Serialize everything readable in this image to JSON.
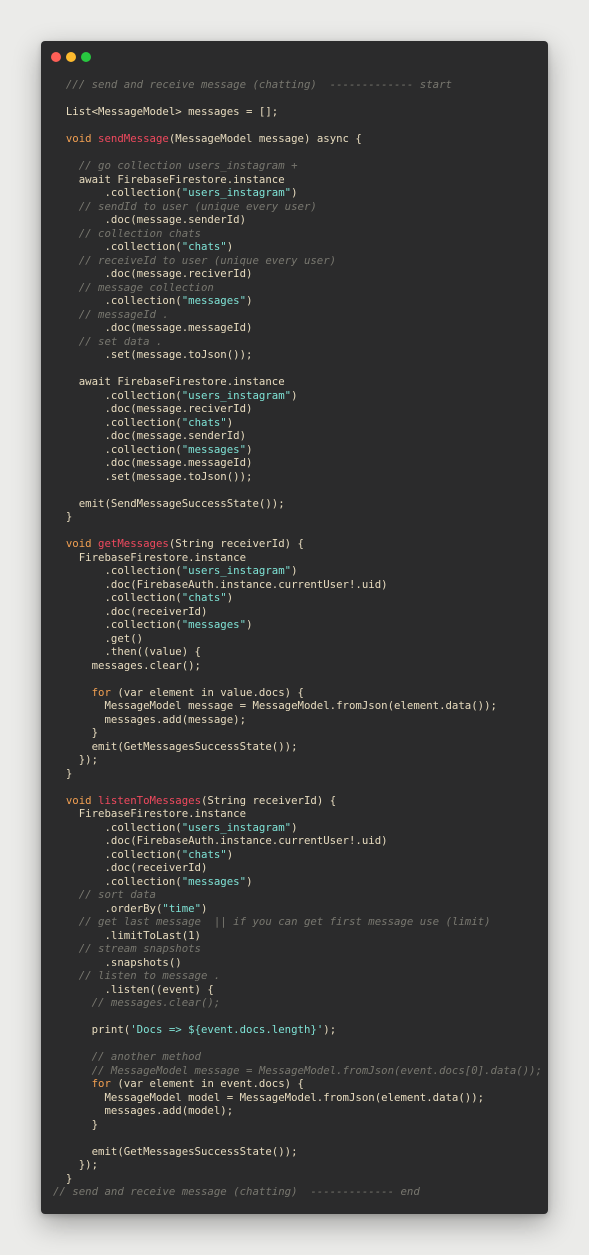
{
  "window": {
    "buttons": [
      "close",
      "minimize",
      "maximize"
    ],
    "colors": {
      "background": "#2b2b2c",
      "close": "#fe5f57",
      "minimize": "#febb2e",
      "maximize": "#28c840"
    }
  },
  "code": {
    "language": "dart",
    "lines": [
      [
        [
          "c",
          "  /// send and receive message (chatting)  ------------- start"
        ]
      ],
      [],
      [
        [
          "p",
          "  List<MessageModel> messages = [];"
        ]
      ],
      [],
      [
        [
          "k",
          "  void "
        ],
        [
          "f",
          "sendMessage"
        ],
        [
          "p",
          "(MessageModel message) async {"
        ]
      ],
      [],
      [
        [
          "c",
          "    // go collection users_instagram +"
        ]
      ],
      [
        [
          "p",
          "    await FirebaseFirestore.instance"
        ]
      ],
      [
        [
          "p",
          "        .collection("
        ],
        [
          "s",
          "\"users_instagram\""
        ],
        [
          "p",
          ")"
        ]
      ],
      [
        [
          "c",
          "    // sendId to user (unique every user)"
        ]
      ],
      [
        [
          "p",
          "        .doc(message.senderId)"
        ]
      ],
      [
        [
          "c",
          "    // collection chats"
        ]
      ],
      [
        [
          "p",
          "        .collection("
        ],
        [
          "s",
          "\"chats\""
        ],
        [
          "p",
          ")"
        ]
      ],
      [
        [
          "c",
          "    // receiveId to user (unique every user)"
        ]
      ],
      [
        [
          "p",
          "        .doc(message.reciverId)"
        ]
      ],
      [
        [
          "c",
          "    // message collection"
        ]
      ],
      [
        [
          "p",
          "        .collection("
        ],
        [
          "s",
          "\"messages\""
        ],
        [
          "p",
          ")"
        ]
      ],
      [
        [
          "c",
          "    // messageId ."
        ]
      ],
      [
        [
          "p",
          "        .doc(message.messageId)"
        ]
      ],
      [
        [
          "c",
          "    // set data ."
        ]
      ],
      [
        [
          "p",
          "        .set(message.toJson());"
        ]
      ],
      [],
      [
        [
          "p",
          "    await FirebaseFirestore.instance"
        ]
      ],
      [
        [
          "p",
          "        .collection("
        ],
        [
          "s",
          "\"users_instagram\""
        ],
        [
          "p",
          ")"
        ]
      ],
      [
        [
          "p",
          "        .doc(message.reciverId)"
        ]
      ],
      [
        [
          "p",
          "        .collection("
        ],
        [
          "s",
          "\"chats\""
        ],
        [
          "p",
          ")"
        ]
      ],
      [
        [
          "p",
          "        .doc(message.senderId)"
        ]
      ],
      [
        [
          "p",
          "        .collection("
        ],
        [
          "s",
          "\"messages\""
        ],
        [
          "p",
          ")"
        ]
      ],
      [
        [
          "p",
          "        .doc(message.messageId)"
        ]
      ],
      [
        [
          "p",
          "        .set(message.toJson());"
        ]
      ],
      [],
      [
        [
          "p",
          "    emit(SendMessageSuccessState());"
        ]
      ],
      [
        [
          "p",
          "  }"
        ]
      ],
      [],
      [
        [
          "k",
          "  void "
        ],
        [
          "f",
          "getMessages"
        ],
        [
          "p",
          "(String receiverId) {"
        ]
      ],
      [
        [
          "p",
          "    FirebaseFirestore.instance"
        ]
      ],
      [
        [
          "p",
          "        .collection("
        ],
        [
          "s",
          "\"users_instagram\""
        ],
        [
          "p",
          ")"
        ]
      ],
      [
        [
          "p",
          "        .doc(FirebaseAuth.instance.currentUser!.uid)"
        ]
      ],
      [
        [
          "p",
          "        .collection("
        ],
        [
          "s",
          "\"chats\""
        ],
        [
          "p",
          ")"
        ]
      ],
      [
        [
          "p",
          "        .doc(receiverId)"
        ]
      ],
      [
        [
          "p",
          "        .collection("
        ],
        [
          "s",
          "\"messages\""
        ],
        [
          "p",
          ")"
        ]
      ],
      [
        [
          "p",
          "        .get()"
        ]
      ],
      [
        [
          "p",
          "        .then((value) {"
        ]
      ],
      [
        [
          "p",
          "      messages.clear();"
        ]
      ],
      [],
      [
        [
          "k",
          "      for "
        ],
        [
          "p",
          "(var element in value.docs) {"
        ]
      ],
      [
        [
          "p",
          "        MessageModel message = MessageModel.fromJson(element.data());"
        ]
      ],
      [
        [
          "p",
          "        messages.add(message);"
        ]
      ],
      [
        [
          "p",
          "      }"
        ]
      ],
      [
        [
          "p",
          "      emit(GetMessagesSuccessState());"
        ]
      ],
      [
        [
          "p",
          "    });"
        ]
      ],
      [
        [
          "p",
          "  }"
        ]
      ],
      [],
      [
        [
          "k",
          "  void "
        ],
        [
          "f",
          "listenToMessages"
        ],
        [
          "p",
          "(String receiverId) {"
        ]
      ],
      [
        [
          "p",
          "    FirebaseFirestore.instance"
        ]
      ],
      [
        [
          "p",
          "        .collection("
        ],
        [
          "s",
          "\"users_instagram\""
        ],
        [
          "p",
          ")"
        ]
      ],
      [
        [
          "p",
          "        .doc(FirebaseAuth.instance.currentUser!.uid)"
        ]
      ],
      [
        [
          "p",
          "        .collection("
        ],
        [
          "s",
          "\"chats\""
        ],
        [
          "p",
          ")"
        ]
      ],
      [
        [
          "p",
          "        .doc(receiverId)"
        ]
      ],
      [
        [
          "p",
          "        .collection("
        ],
        [
          "s",
          "\"messages\""
        ],
        [
          "p",
          ")"
        ]
      ],
      [
        [
          "c",
          "    // sort data"
        ]
      ],
      [
        [
          "p",
          "        .orderBy("
        ],
        [
          "s",
          "\"time\""
        ],
        [
          "p",
          ")"
        ]
      ],
      [
        [
          "c",
          "    // get last message  || if you can get first message use (limit)"
        ]
      ],
      [
        [
          "p",
          "        .limitToLast(1)"
        ]
      ],
      [
        [
          "c",
          "    // stream snapshots"
        ]
      ],
      [
        [
          "p",
          "        .snapshots()"
        ]
      ],
      [
        [
          "c",
          "    // listen to message ."
        ]
      ],
      [
        [
          "p",
          "        .listen((event) {"
        ]
      ],
      [
        [
          "c",
          "      // messages.clear();"
        ]
      ],
      [],
      [
        [
          "p",
          "      print("
        ],
        [
          "s",
          "'Docs => ${event.docs.length}'"
        ],
        [
          "p",
          ");"
        ]
      ],
      [],
      [
        [
          "c",
          "      // another method"
        ]
      ],
      [
        [
          "c",
          "      // MessageModel message = MessageModel.fromJson(event.docs[0].data());"
        ]
      ],
      [
        [
          "k",
          "      for "
        ],
        [
          "p",
          "(var element in event.docs) {"
        ]
      ],
      [
        [
          "p",
          "        MessageModel model = MessageModel.fromJson(element.data());"
        ]
      ],
      [
        [
          "p",
          "        messages.add(model);"
        ]
      ],
      [
        [
          "p",
          "      }"
        ]
      ],
      [],
      [
        [
          "p",
          "      emit(GetMessagesSuccessState());"
        ]
      ],
      [
        [
          "p",
          "    });"
        ]
      ],
      [
        [
          "p",
          "  }"
        ]
      ],
      [
        [
          "c",
          "// send and receive message (chatting)  ------------- end"
        ]
      ]
    ]
  }
}
